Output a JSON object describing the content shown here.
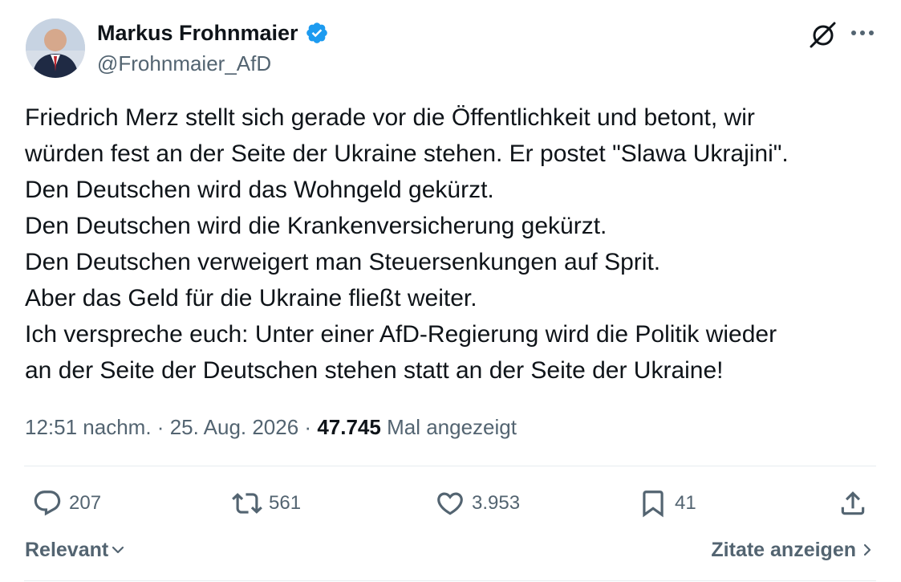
{
  "author": {
    "name": "Markus Frohnmaier",
    "handle": "@Frohnmaier_AfD",
    "verified": true
  },
  "tweet": {
    "lines": [
      "Friedrich Merz stellt sich gerade vor die Öffentlichkeit und betont, wir",
      "würden fest an der Seite der Ukraine stehen. Er postet \"Slawa Ukrajini\".",
      "Den Deutschen wird das Wohngeld gekürzt.",
      "Den Deutschen wird die Krankenversicherung gekürzt.",
      "Den Deutschen verweigert man Steuersenkungen auf Sprit.",
      "Aber das Geld für die Ukraine fließt weiter.",
      "Ich verspreche euch: Unter einer AfD-Regierung wird die Politik wieder",
      "an der Seite der Deutschen stehen statt an der Seite der Ukraine!"
    ]
  },
  "meta": {
    "time": "12:51 nachm.",
    "separator": "·",
    "date": "25. Aug. 2026",
    "views_count": "47.745",
    "views_label": "Mal angezeigt"
  },
  "actions": {
    "replies": "207",
    "reposts": "561",
    "likes": "3.953",
    "bookmarks": "41"
  },
  "footer": {
    "sort_label": "Relevant",
    "quotes_label": "Zitate anzeigen"
  },
  "icons": [
    "verified-badge-icon",
    "grok-icon",
    "more-icon",
    "reply-icon",
    "repost-icon",
    "like-icon",
    "bookmark-icon",
    "share-icon",
    "chevron-down-icon",
    "chevron-right-icon"
  ],
  "colors": {
    "text": "#0f1419",
    "secondary": "#536471",
    "verified": "#1d9bf0",
    "divider": "#e6ecf0"
  }
}
